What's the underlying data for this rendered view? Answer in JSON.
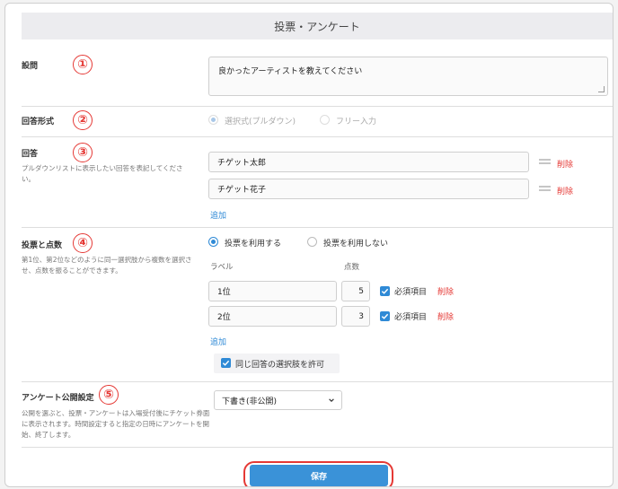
{
  "title": "投票・アンケート",
  "markers": [
    "①",
    "②",
    "③",
    "④",
    "⑤"
  ],
  "question": {
    "label": "設問",
    "value": "良かったアーティストを教えてください"
  },
  "answer_format": {
    "label": "回答形式",
    "options": [
      {
        "label": "選択式(プルダウン)",
        "selected": true
      },
      {
        "label": "フリー入力",
        "selected": false
      }
    ]
  },
  "answers": {
    "label": "回答",
    "description": "プルダウンリストに表示したい回答を表記してください。",
    "items": [
      "チゲット太郎",
      "チゲット花子"
    ],
    "delete_label": "削除",
    "add_label": "追加"
  },
  "voting": {
    "label": "投票と点数",
    "description": "第1位、第2位などのように同一選択肢から複数を選択させ、点数を振ることができます。",
    "options": [
      {
        "label": "投票を利用する",
        "selected": true
      },
      {
        "label": "投票を利用しない",
        "selected": false
      }
    ],
    "col_label": "ラベル",
    "col_points": "点数",
    "rows": [
      {
        "label": "1位",
        "points": "5",
        "required_label": "必須項目",
        "required": true
      },
      {
        "label": "2位",
        "points": "3",
        "required_label": "必須項目",
        "required": true
      }
    ],
    "delete_label": "削除",
    "add_label": "追加",
    "allow_same_label": "同じ回答の選択肢を許可",
    "allow_same": true
  },
  "publish": {
    "label": "アンケート公開設定",
    "description": "公開を選ぶと、投票・アンケートは入場受付後にチケット券面に表示されます。時間設定すると指定の日時にアンケートを開始、終了します。",
    "selected": "下書き(非公開)"
  },
  "save_label": "保存",
  "colors": {
    "accent": "#2f8ad6",
    "delete": "#e53935",
    "marker": "#e53935"
  }
}
